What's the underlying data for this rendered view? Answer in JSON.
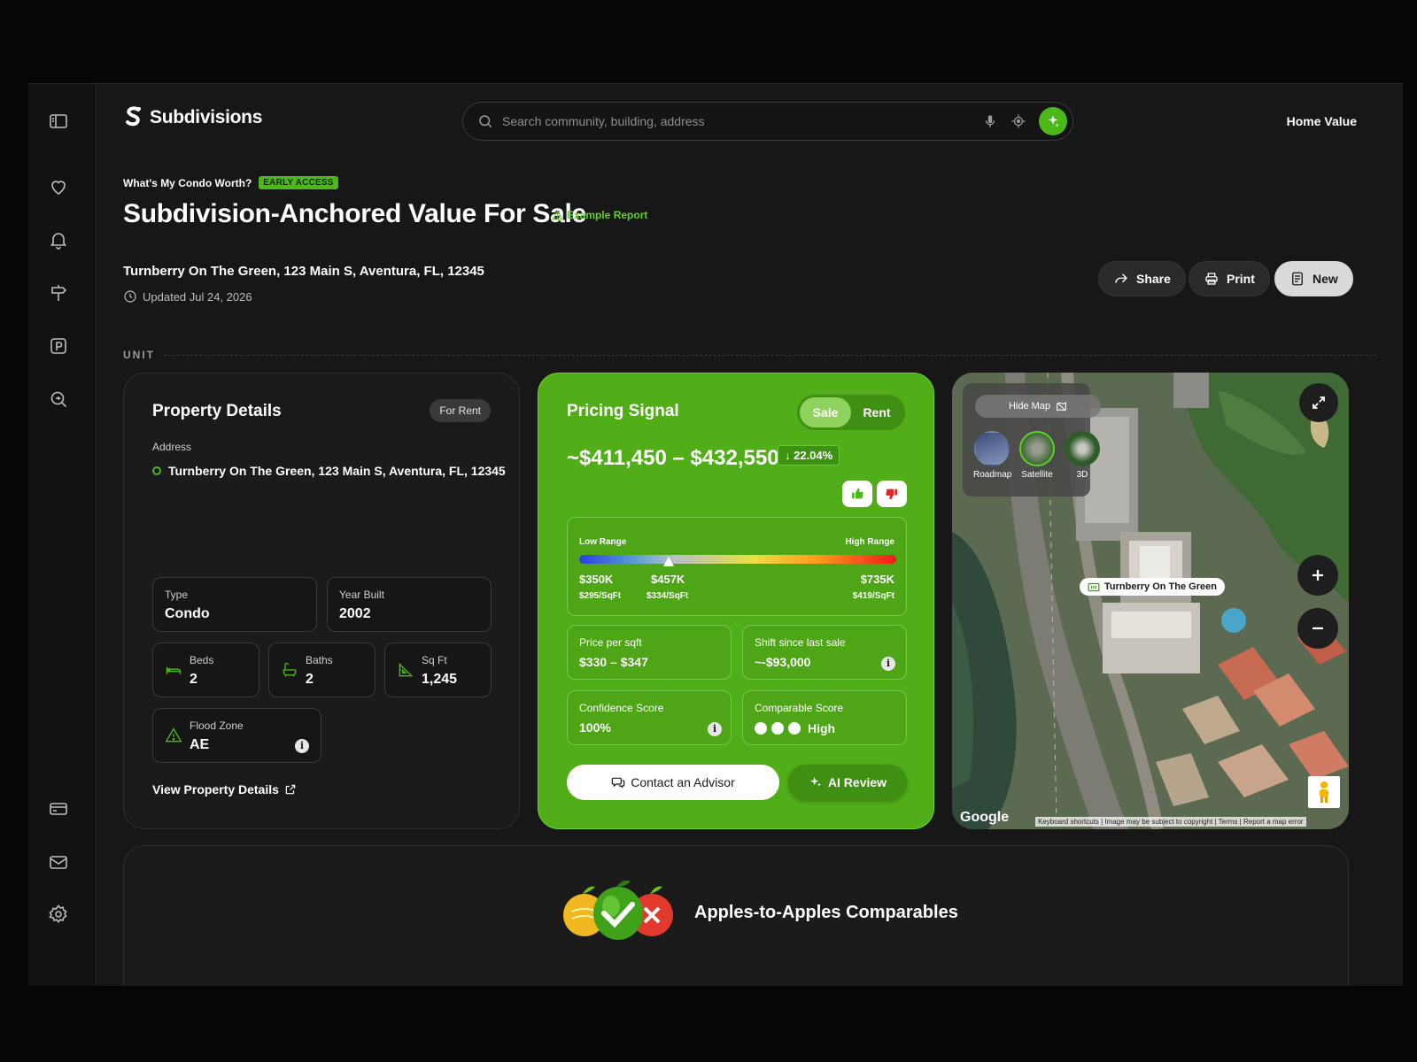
{
  "brand": {
    "name": "Subdivisions",
    "accent": "#4cb81a"
  },
  "sidebar": {
    "items": [
      {
        "icon": "sidebar-toggle-icon"
      },
      {
        "icon": "heart-icon"
      },
      {
        "icon": "bell-icon"
      },
      {
        "icon": "signpost-icon"
      },
      {
        "icon": "parking-icon"
      },
      {
        "icon": "zoom-search-icon"
      },
      {
        "icon": "card-icon"
      },
      {
        "icon": "mail-icon"
      },
      {
        "icon": "gear-icon"
      }
    ]
  },
  "header": {
    "search_placeholder": "Search community, building, address",
    "nav_link": "Home Value"
  },
  "page": {
    "eyebrow": "What's My Condo Worth?",
    "eyebrow_badge": "EARLY ACCESS",
    "title": "Subdivision-Anchored Value For Sale",
    "example_label": "Example Report",
    "address": "Turnberry On The Green, 123 Main S, Aventura, FL, 12345",
    "updated": "Updated Jul 24, 2026",
    "actions": {
      "share": "Share",
      "print": "Print",
      "new": "New"
    },
    "section_label": "UNIT"
  },
  "property": {
    "title": "Property Details",
    "pill": "For Rent",
    "address_label": "Address",
    "address": "Turnberry On The Green, 123 Main S, Aventura, FL, 12345",
    "type_label": "Type",
    "type": "Condo",
    "year_label": "Year Built",
    "year": "2002",
    "beds_label": "Beds",
    "beds": "2",
    "baths_label": "Baths",
    "baths": "2",
    "sqft_label": "Sq Ft",
    "sqft": "1,245",
    "flood_label": "Flood Zone",
    "flood": "AE",
    "view_link": "View Property Details"
  },
  "pricing": {
    "title": "Pricing Signal",
    "tabs": [
      "Sale",
      "Rent"
    ],
    "active_tab": "Sale",
    "range": "~$411,450 – $432,550",
    "delta": "↓ 22.04%",
    "low_range_label": "Low Range",
    "high_range_label": "High Range",
    "low_value": "$350K",
    "low_sqft": "$295/SqFt",
    "mid_value": "$457K",
    "mid_sqft": "$334/SqFt",
    "high_value": "$735K",
    "high_sqft": "$419/SqFt",
    "price_per_sqft_label": "Price per sqft",
    "price_per_sqft": "$330 – $347",
    "shift_label": "Shift since last sale",
    "shift": "~-$93,000",
    "confidence_label": "Confidence Score",
    "confidence": "100%",
    "comparable_label": "Comparable Score",
    "comparable": "High",
    "contact_button": "Contact an Advisor",
    "ai_button": "AI Review"
  },
  "map": {
    "hide_map": "Hide Map",
    "layers": [
      "Roadmap",
      "Satellite",
      "3D"
    ],
    "active_layer": "Satellite",
    "pin_label": "Turnberry On The Green",
    "google": "Google",
    "attribution": "Keyboard shortcuts | Image may be subject to copyright | Terms | Report a map error"
  },
  "comparables": {
    "title": "Apples-to-Apples Comparables"
  }
}
